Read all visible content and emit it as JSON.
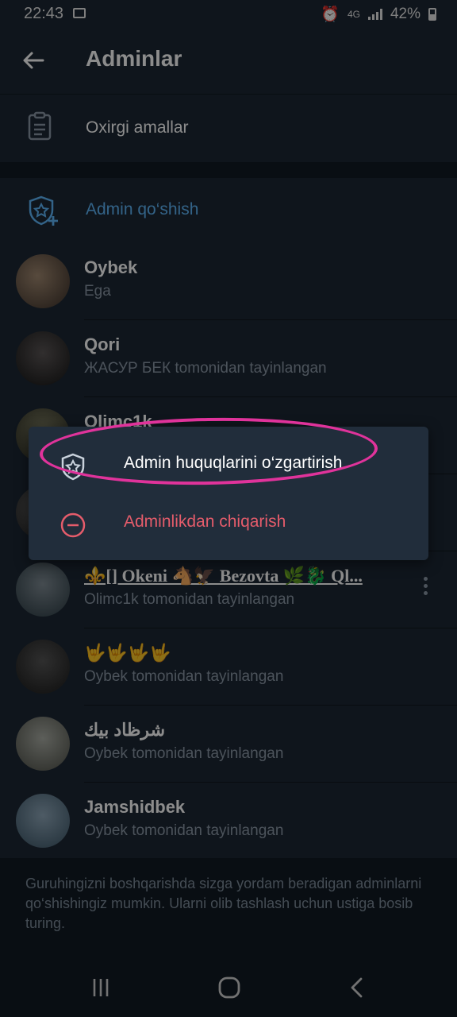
{
  "status_bar": {
    "time": "22:43",
    "network": "4G",
    "battery": "42%"
  },
  "header": {
    "title": "Adminlar"
  },
  "recent_actions": {
    "label": "Oxirgi amallar"
  },
  "add_admin": {
    "label": "Admin qo‘shish"
  },
  "admins": [
    {
      "name": "Oybek",
      "subtitle": "Ega",
      "avatar": "avatar-1"
    },
    {
      "name": "Qori",
      "subtitle": "ЖАСУР БЕК tomonidan tayinlangan",
      "avatar": "avatar-2"
    },
    {
      "name": "Olimc1k",
      "subtitle": "",
      "avatar": "avatar-3"
    },
    {
      "name": "",
      "subtitle": "",
      "avatar": "avatar-4"
    },
    {
      "name": "⚜️[] Okeni 🐴🦅 Bezovta 🌿🐉 Ql...",
      "subtitle": "Olimc1k tomonidan tayinlangan",
      "avatar": "avatar-5"
    },
    {
      "name": "🤟🤟🤟🤟",
      "subtitle": "Oybek tomonidan tayinlangan",
      "avatar": "avatar-6"
    },
    {
      "name": "شرظاد بيك",
      "subtitle": "Oybek tomonidan tayinlangan",
      "avatar": "avatar-7"
    },
    {
      "name": "Jamshidbek",
      "subtitle": "Oybek tomonidan tayinlangan",
      "avatar": "avatar-8"
    }
  ],
  "footer": {
    "hint": "Guruhingizni boshqarishda sizga yordam beradigan adminlarni qo‘shishingiz mumkin. Ularni olib tashlash uchun ustiga bosib turing."
  },
  "context_menu": {
    "edit_label": "Admin huquqlarini o‘zgartirish",
    "remove_label": "Adminlikdan chiqarish"
  },
  "colors": {
    "accent": "#5eb5f7",
    "danger": "#e55c6b",
    "annotation": "#e0339b"
  }
}
